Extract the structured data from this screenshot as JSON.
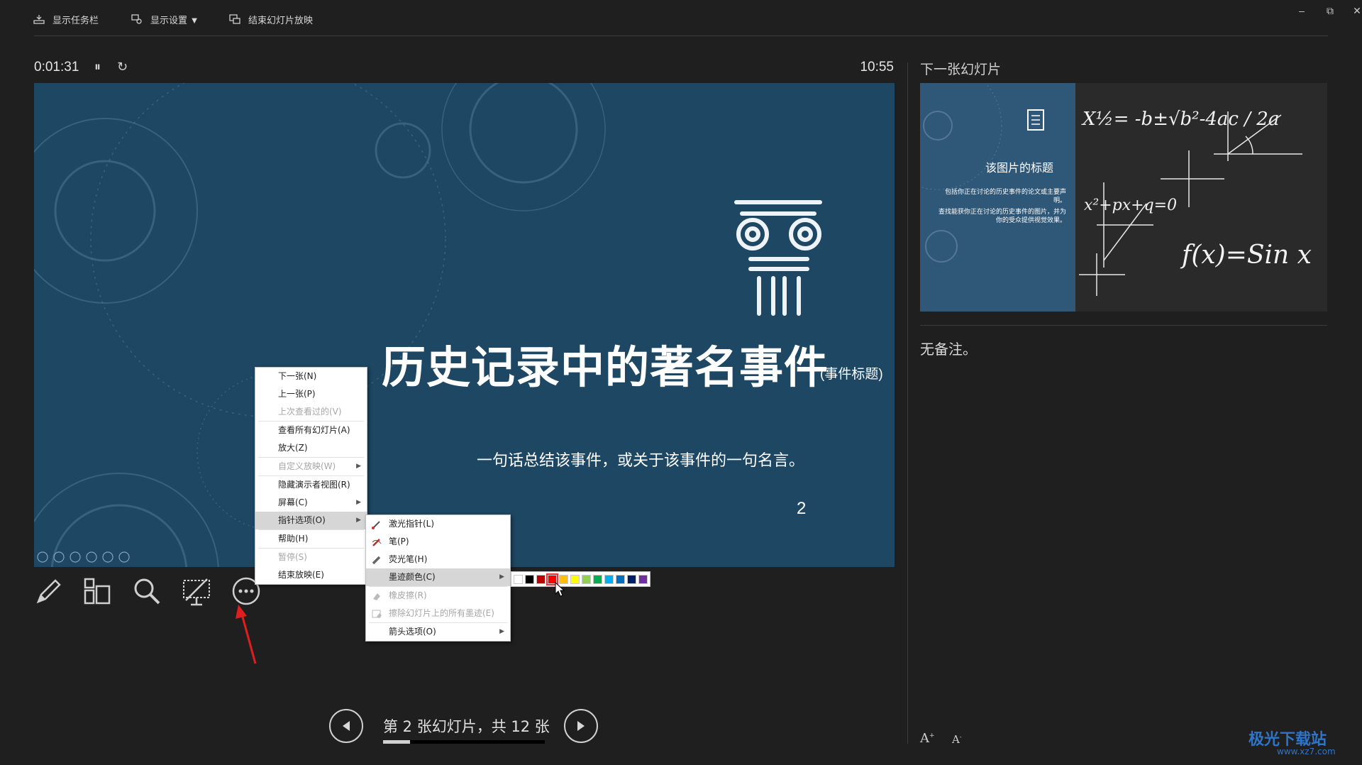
{
  "toolbar": {
    "show_taskbar": "显示任务栏",
    "display_settings": "显示设置 ▼",
    "end_slideshow": "结束幻灯片放映"
  },
  "window_controls": {
    "minimize": "–",
    "restore": "⧉",
    "close": "✕"
  },
  "presenter": {
    "elapsed_time": "0:01:31",
    "pause_icon": "⏸",
    "reset_icon": "↻",
    "clock": "10:55"
  },
  "slide": {
    "title": "历史记录中的著名事件",
    "title_suffix": "(事件标题)",
    "subtitle": "一句话总结该事件，或关于该事件的一句名言。",
    "number": "2",
    "background_color": "#1e4763"
  },
  "tools": [
    "pen-tool-icon",
    "view-all-slides-icon",
    "zoom-icon",
    "screen-toggle-icon",
    "more-options-icon"
  ],
  "context_menu": {
    "items": [
      {
        "label": "下一张(N)",
        "disabled": false
      },
      {
        "label": "上一张(P)",
        "disabled": false
      },
      {
        "label": "上次查看过的(V)",
        "disabled": true
      },
      {
        "label": "查看所有幻灯片(A)",
        "disabled": false
      },
      {
        "label": "放大(Z)",
        "disabled": false
      },
      {
        "label": "自定义放映(W)",
        "disabled": true
      },
      {
        "label": "隐藏演示者视图(R)",
        "disabled": false
      },
      {
        "label": "屏幕(C)",
        "disabled": false
      },
      {
        "label": "指针选项(O)",
        "disabled": false
      },
      {
        "label": "帮助(H)",
        "disabled": false
      },
      {
        "label": "暂停(S)",
        "disabled": true
      },
      {
        "label": "结束放映(E)",
        "disabled": false
      }
    ]
  },
  "pointer_submenu": {
    "items": [
      {
        "label": "激光指针(L)",
        "disabled": false
      },
      {
        "label": "笔(P)",
        "disabled": false
      },
      {
        "label": "荧光笔(H)",
        "disabled": false
      },
      {
        "label": "墨迹颜色(C)",
        "disabled": false
      },
      {
        "label": "橡皮擦(R)",
        "disabled": true
      },
      {
        "label": "擦除幻灯片上的所有墨迹(E)",
        "disabled": true
      },
      {
        "label": "箭头选项(O)",
        "disabled": false
      }
    ]
  },
  "ink_colors": [
    "#ffffff",
    "#000000",
    "#c00000",
    "#ff0000",
    "#ffc000",
    "#ffff00",
    "#92d050",
    "#00b050",
    "#00b0f0",
    "#0070c0",
    "#002060",
    "#7030a0"
  ],
  "selected_ink_color": "#ff0000",
  "navigation": {
    "slide_status": "第 2 张幻灯片，共 12 张",
    "current_slide": 2,
    "total_slides": 12
  },
  "next_slide": {
    "label": "下一张幻灯片",
    "title": "该图片的标题",
    "body_line1": "包括你正在讨论的历史事件的论文或主要声明。",
    "body_line2": "查找能获你正在讨论的历史事件的图片，并为你的受众提供视觉效果。",
    "formula1": "X½= -b±√b²-4ac / 2a",
    "formula2": "x²+px+q=0",
    "formula3": "f(x)=Sin x"
  },
  "notes": {
    "text": "无备注。"
  },
  "font_controls": {
    "increase": "A",
    "decrease": "A"
  },
  "watermark": {
    "name": "极光下载站",
    "url": "www.xz7.com"
  }
}
